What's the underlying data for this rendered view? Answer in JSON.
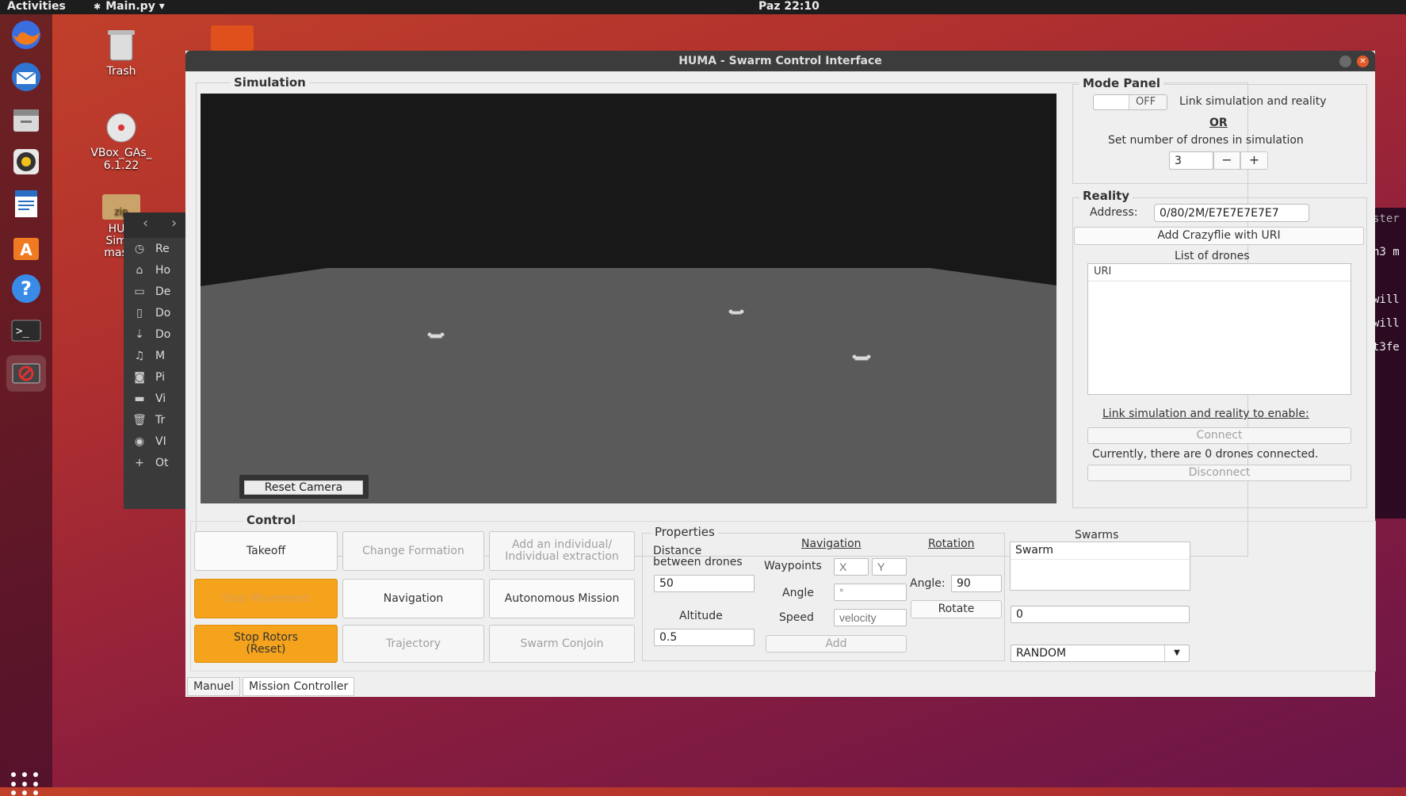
{
  "topbar": {
    "activities": "Activities",
    "app_name": "Main.py ▾",
    "clock": "Paz 22:10"
  },
  "desktop": {
    "trash": "Trash",
    "vbox": "VBox_GAs_\n6.1.22",
    "huma": "HUM\nSimul\nmaste"
  },
  "window": {
    "title": "HUMA - Swarm Control Interface"
  },
  "simulation": {
    "label": "Simulation",
    "reset_camera": "Reset Camera"
  },
  "mode_panel": {
    "label": "Mode Panel",
    "toggle_state": "OFF",
    "link_text": "Link simulation and reality",
    "or_text": "OR",
    "set_number_text": "Set number of drones in simulation",
    "drone_count": "3",
    "minus": "−",
    "plus": "+"
  },
  "reality": {
    "label": "Reality",
    "address_label": "Address:",
    "address_value": "0/80/2M/E7E7E7E7E7",
    "add_button": "Add Crazyflie with URI",
    "list_title": "List of drones",
    "list_header": "URI",
    "link_enable": "Link simulation and reality to enable:",
    "connect": "Connect",
    "status": "Currently, there are 0 drones connected.",
    "disconnect": "Disconnect"
  },
  "control": {
    "label": "Control",
    "takeoff": "Takeoff",
    "change_formation": "Change Formation",
    "add_individual": "Add an individual/\nIndividual extraction",
    "stop_movement": "Stop Movement",
    "navigation": "Navigation",
    "autonomous_mission": "Autonomous Mission",
    "stop_rotors": "Stop Rotors\n(Reset)",
    "trajectory": "Trajectory",
    "swarm_conjoin": "Swarm Conjoin"
  },
  "properties": {
    "label": "Properties",
    "distance_label": "Distance\nbetween drones",
    "distance_value": "50",
    "altitude_label": "Altitude",
    "altitude_value": "0.5"
  },
  "navigation_panel": {
    "title": "Navigation",
    "waypoints_label": "Waypoints",
    "x_placeholder": "X",
    "y_placeholder": "Y",
    "angle_label": "Angle",
    "angle_placeholder": "°",
    "speed_label": "Speed",
    "speed_placeholder": "velocity",
    "add_button": "Add"
  },
  "rotation_panel": {
    "title": "Rotation",
    "angle_label": "Angle:",
    "angle_value": "90",
    "rotate_button": "Rotate"
  },
  "swarms": {
    "title": "Swarms",
    "items": [
      "Swarm"
    ],
    "number_value": "0",
    "mode_value": "RANDOM"
  },
  "tabs": [
    "Manuel",
    "Mission Controller"
  ],
  "files_sidebar": [
    "Re",
    "Ho",
    "De",
    "Do",
    "Do",
    "M",
    "Pi",
    "Vi",
    "Tr",
    "VI",
    "Ot"
  ],
  "terminal_lines": [
    "ster",
    "n3 m",
    "will",
    "will",
    "t3fe"
  ]
}
